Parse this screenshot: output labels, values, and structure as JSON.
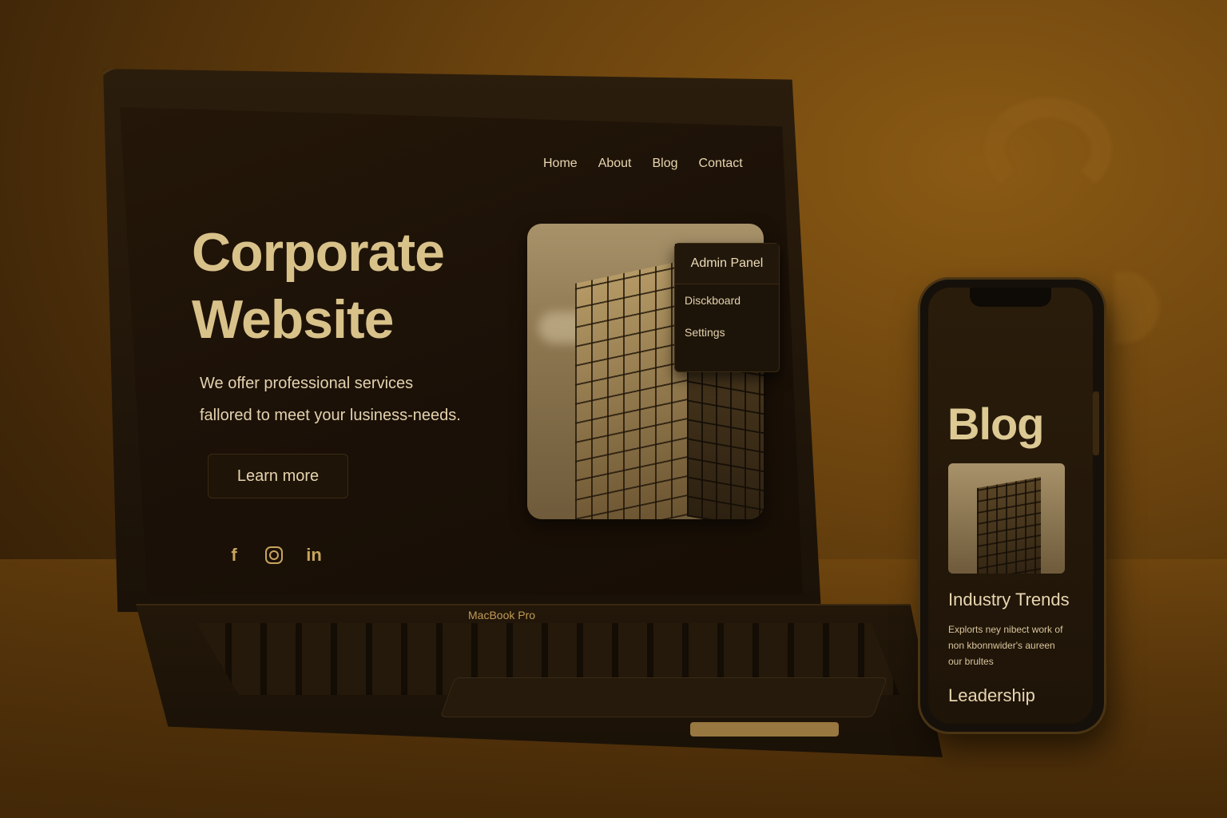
{
  "laptop": {
    "brand_label": "MacBook Pro",
    "nav": [
      "Home",
      "About",
      "Blog",
      "Contact"
    ],
    "hero": {
      "title_line1": "Corporate",
      "title_line2": "Website",
      "subtitle_line1": "We offer professional services",
      "subtitle_line2": "fallored to meet your lusiness-needs.",
      "cta_label": "Learn more"
    },
    "social": [
      {
        "icon": "facebook-icon",
        "glyph": "f"
      },
      {
        "icon": "instagram-icon",
        "glyph": ""
      },
      {
        "icon": "linkedin-icon",
        "glyph": "in"
      }
    ],
    "admin_menu": {
      "header": "Admin Panel",
      "items": [
        "Disckboard",
        "Settings"
      ]
    }
  },
  "phone": {
    "title": "Blog",
    "post1_title": "Industry Trends",
    "post1_excerpt": "Explorts ney nibect work of non kbonnwider's aureen our brultes",
    "post2_title": "Leadership"
  },
  "colors": {
    "accent": "#d9c28a",
    "background": "#6b430e",
    "screen": "#1a1007"
  }
}
